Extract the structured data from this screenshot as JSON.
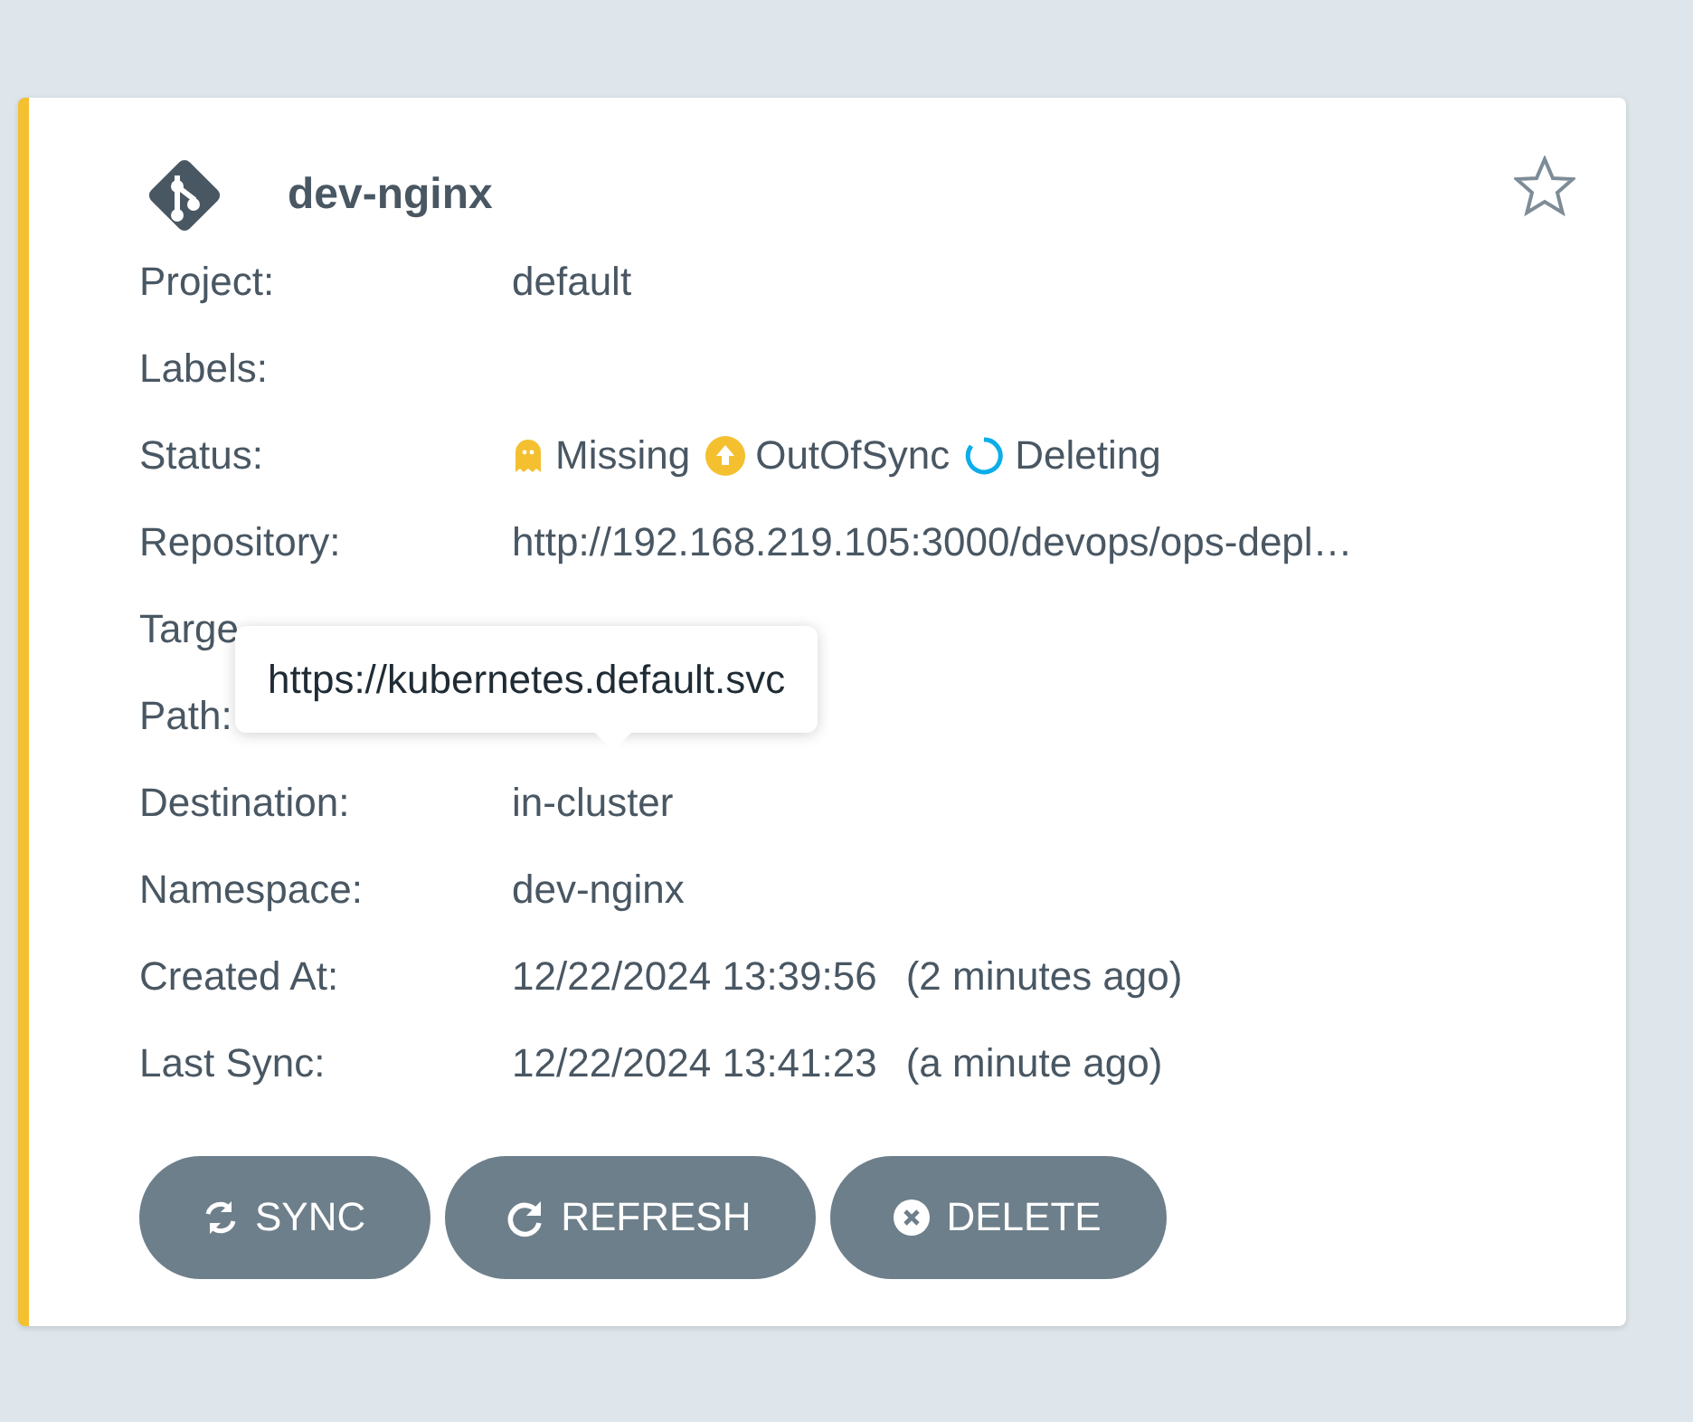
{
  "app": {
    "name": "dev-nginx",
    "favorite": false,
    "fields": [
      {
        "kind": "text",
        "label": "Project:",
        "value": "default"
      },
      {
        "kind": "text",
        "label": "Labels:"
      },
      {
        "kind": "status",
        "label": "Status:",
        "statuses": [
          {
            "kind": "missing",
            "text": "Missing"
          },
          {
            "kind": "outofsync",
            "text": "OutOfSync"
          },
          {
            "kind": "deleting",
            "text": "Deleting"
          }
        ]
      },
      {
        "kind": "text",
        "label": "Repository:",
        "value": "http://192.168.219.105:3000/devops/ops-depl…"
      },
      {
        "kind": "text",
        "label": "Targe"
      },
      {
        "kind": "text",
        "label": "Path:"
      },
      {
        "kind": "text",
        "label": "Destination:",
        "value": "in-cluster"
      },
      {
        "kind": "text",
        "label": "Namespace:",
        "value": "dev-nginx"
      },
      {
        "kind": "time",
        "label": "Created At:",
        "value": "12/22/2024 13:39:56",
        "ago": "(2 minutes ago)"
      },
      {
        "kind": "time",
        "label": "Last Sync:",
        "value": "12/22/2024 13:41:23",
        "ago": "(a minute ago)"
      }
    ],
    "tooltip": "https://kubernetes.default.svc",
    "buttons": [
      {
        "kind": "sync",
        "label": "SYNC"
      },
      {
        "kind": "refresh",
        "label": "REFRESH"
      },
      {
        "kind": "delete",
        "label": "DELETE"
      }
    ]
  }
}
